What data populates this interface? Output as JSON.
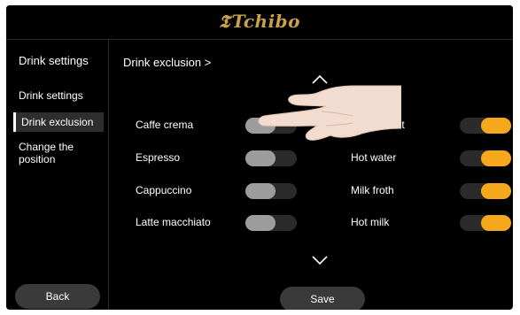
{
  "header": {
    "brand": "Tchibo",
    "brand_mark": "𝕿"
  },
  "sidebar": {
    "title": "Drink settings",
    "items": [
      {
        "label": "Drink settings",
        "active": false
      },
      {
        "label": "Drink exclusion",
        "active": true
      },
      {
        "label": "Change the position",
        "active": false
      }
    ],
    "back_label": "Back"
  },
  "main": {
    "title": "Drink exclusion >",
    "scroll_up_icon": "chevron-up-icon",
    "scroll_down_icon": "chevron-down-icon",
    "left_drinks": [
      {
        "label": "Caffe crema",
        "enabled": false
      },
      {
        "label": "Espresso",
        "enabled": false
      },
      {
        "label": "Cappuccino",
        "enabled": false
      },
      {
        "label": "Latte macchiato",
        "enabled": false
      }
    ],
    "right_drinks": [
      {
        "label": "Café au lait",
        "enabled": true
      },
      {
        "label": "Hot water",
        "enabled": true
      },
      {
        "label": "Milk froth",
        "enabled": true
      },
      {
        "label": "Hot milk",
        "enabled": true
      }
    ],
    "save_label": "Save"
  },
  "colors": {
    "accent_on": "#f6a81c",
    "knob_off": "#9c9c9c",
    "brand_gold": "#c9a14a",
    "background": "#000000"
  }
}
